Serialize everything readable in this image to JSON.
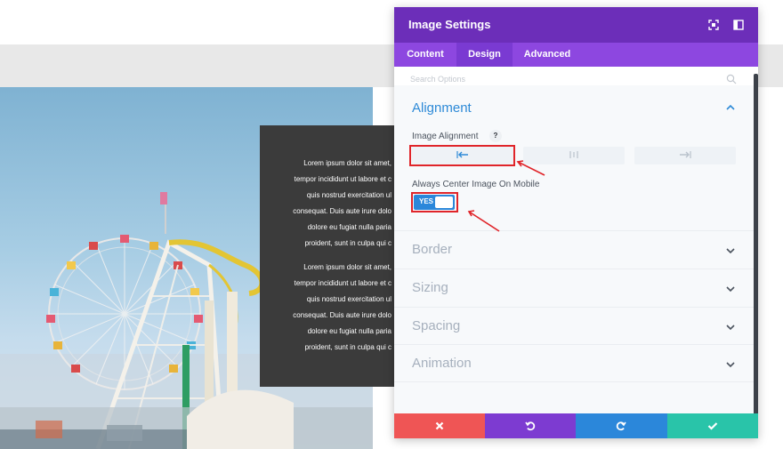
{
  "modal": {
    "title": "Image Settings",
    "tabs": [
      {
        "label": "Content",
        "active": false
      },
      {
        "label": "Design",
        "active": true
      },
      {
        "label": "Advanced",
        "active": false
      }
    ],
    "search_placeholder": "Search Options"
  },
  "sections": {
    "alignment": "Alignment",
    "border": "Border",
    "sizing": "Sizing",
    "spacing": "Spacing",
    "animation": "Animation"
  },
  "options": {
    "image_alignment_label": "Image Alignment",
    "help_text": "?",
    "alignment_options": [
      "left",
      "center",
      "right"
    ],
    "alignment_selected": "left",
    "center_mobile_label": "Always Center Image On Mobile",
    "center_mobile_value": "YES"
  },
  "preview_text": {
    "paragraph_1": [
      "Lorem ipsum dolor sit amet,",
      "tempor incididunt ut labore et c",
      "quis nostrud exercitation ul",
      "consequat. Duis aute irure dolo",
      "dolore eu fugiat nulla paria",
      "proident, sunt in culpa qui c"
    ],
    "paragraph_2": [
      "Lorem ipsum dolor sit amet,",
      "tempor incididunt ut labore et c",
      "quis nostrud exercitation ul",
      "consequat. Duis aute irure dolo",
      "dolore eu fugiat nulla paria",
      "proident, sunt in culpa qui c"
    ]
  },
  "footer": {
    "buttons": [
      "close",
      "undo",
      "redo",
      "save"
    ]
  },
  "colors": {
    "header": "#6c2eb9",
    "tabs": "#8d47e0",
    "accent_blue": "#2b87da",
    "close": "#ef5555",
    "undo": "#7d3bd1",
    "redo": "#2b87da",
    "save": "#29c4a9",
    "annotation_red": "#e0252a"
  }
}
